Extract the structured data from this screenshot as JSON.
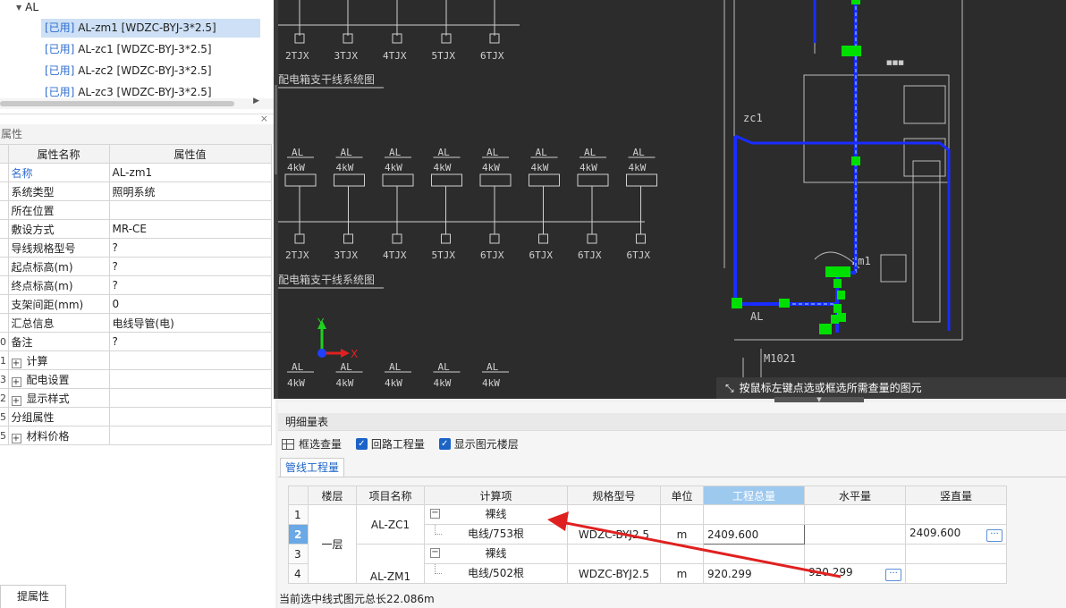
{
  "tree": {
    "root_label": "AL",
    "items": [
      {
        "tag": "[已用]",
        "label": " AL-zm1 [WDZC-BYJ-3*2.5]",
        "selected": true
      },
      {
        "tag": "[已用]",
        "label": " AL-zc1 [WDZC-BYJ-3*2.5]",
        "selected": false
      },
      {
        "tag": "[已用]",
        "label": " AL-zc2 [WDZC-BYJ-3*2.5]",
        "selected": false
      },
      {
        "tag": "[已用]",
        "label": " AL-zc3 [WDZC-BYJ-3*2.5]",
        "selected": false
      }
    ]
  },
  "properties": {
    "panel_title": "属性",
    "close_glyph": "×",
    "col_name": "属性名称",
    "col_value": "属性值",
    "rows": [
      {
        "idx": "",
        "name": "名称",
        "value": "AL-zm1",
        "blue": true
      },
      {
        "idx": "",
        "name": "系统类型",
        "value": "照明系统"
      },
      {
        "idx": "",
        "name": "所在位置",
        "value": ""
      },
      {
        "idx": "",
        "name": "敷设方式",
        "value": "MR-CE"
      },
      {
        "idx": "",
        "name": "导线规格型号",
        "value": "?"
      },
      {
        "idx": "",
        "name": "起点标高(m)",
        "value": "?"
      },
      {
        "idx": "",
        "name": "终点标高(m)",
        "value": "?"
      },
      {
        "idx": "",
        "name": "支架间距(mm)",
        "value": "0"
      },
      {
        "idx": "",
        "name": "汇总信息",
        "value": "电线导管(电)"
      },
      {
        "idx": "0",
        "name": "备注",
        "value": "?"
      },
      {
        "idx": "1",
        "name": "计算",
        "value": "",
        "expand": true
      },
      {
        "idx": "3",
        "name": "配电设置",
        "value": "",
        "expand": true
      },
      {
        "idx": "2",
        "name": "显示样式",
        "value": "",
        "expand": true
      },
      {
        "idx": "5",
        "name": "分组属性",
        "value": ""
      },
      {
        "idx": "5",
        "name": "材料价格",
        "value": "",
        "expand": true
      }
    ]
  },
  "bottom_tab": {
    "label": "提属性"
  },
  "cad": {
    "hint": "按鼠标左键点选或框选所需查量的图元",
    "top_labels": [
      "2TJX",
      "3TJX",
      "4TJX",
      "5TJX",
      "6TJX"
    ],
    "title1": "配电箱支干线系统图",
    "mid_al": [
      "AL",
      "AL",
      "AL",
      "AL",
      "AL",
      "AL",
      "AL",
      "AL"
    ],
    "mid_kw": [
      "4kW",
      "4kW",
      "4kW",
      "4kW",
      "4kW",
      "4kW",
      "4kW",
      "4kW"
    ],
    "bottom_labels": [
      "2TJX",
      "3TJX",
      "4TJX",
      "5TJX",
      "6TJX",
      "6TJX",
      "6TJX",
      "6TJX"
    ],
    "title2": "配电箱支干线系统图",
    "low_al": [
      "AL",
      "AL",
      "AL",
      "AL",
      "AL"
    ],
    "low_kw": [
      "4kW",
      "4kW",
      "4kW",
      "4kW",
      "4kW"
    ],
    "axis_y": "Y",
    "axis_x": "X",
    "room_labels": {
      "zc1": "zc1",
      "zm1": "zm1",
      "al": "AL",
      "door": "M1021"
    }
  },
  "detail": {
    "title": "明细量表",
    "toolbar": {
      "select_qty": "框选查量",
      "loop_qty": "回路工程量",
      "show_floor": "显示图元楼层"
    },
    "tab": "管线工程量",
    "headers": [
      "",
      "楼层",
      "项目名称",
      "计算项",
      "规格型号",
      "单位",
      "工程总量",
      "水平量",
      "竖直量"
    ],
    "floor": "一层",
    "rows": [
      {
        "no": "1",
        "project": "AL-ZC1",
        "calc": "裸线",
        "spec": "",
        "unit": "",
        "total": "",
        "horizontal": "",
        "vertical": "",
        "group": true
      },
      {
        "no": "2",
        "project": "",
        "calc": "电线/753根",
        "spec": "WDZC-BYJ2.5",
        "unit": "m",
        "total": "2409.600",
        "horizontal": "",
        "vertical": "2409.600",
        "selected": true
      },
      {
        "no": "3",
        "project": "AL-ZM1",
        "calc": "裸线",
        "spec": "",
        "unit": "",
        "total": "",
        "horizontal": "",
        "vertical": "",
        "group": true
      },
      {
        "no": "4",
        "project": "",
        "calc": "电线/502根",
        "spec": "WDZC-BYJ2.5",
        "unit": "m",
        "total": "920.299",
        "horizontal": "920.299",
        "vertical": ""
      }
    ],
    "ellipsis": "···"
  },
  "status": "当前选中线式图元总长22.086m",
  "colors": {
    "accent": "#1b63c6",
    "selection": "#cde0f5",
    "wire": "#1a2cff",
    "node": "#00e000",
    "arrow": "#e02020"
  }
}
